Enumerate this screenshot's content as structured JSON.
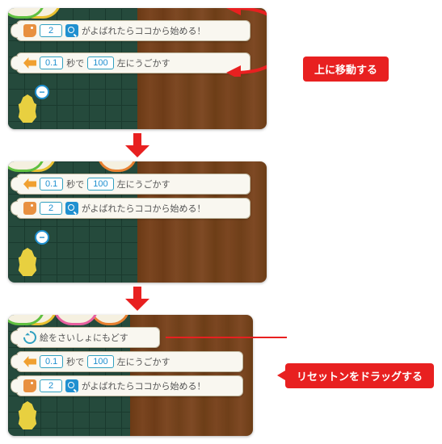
{
  "labels": {
    "move_up": "上に移動する",
    "drag_reset": "リセットンをドラッグする"
  },
  "blocks": {
    "event": {
      "number": "2",
      "text": "がよばれたらココから始める！"
    },
    "move": {
      "seconds": "0.1",
      "sec_label": "秒で",
      "distance": "100",
      "direction": "左にうごかす"
    },
    "reset": {
      "text": "絵をさいしょにもどす"
    }
  }
}
